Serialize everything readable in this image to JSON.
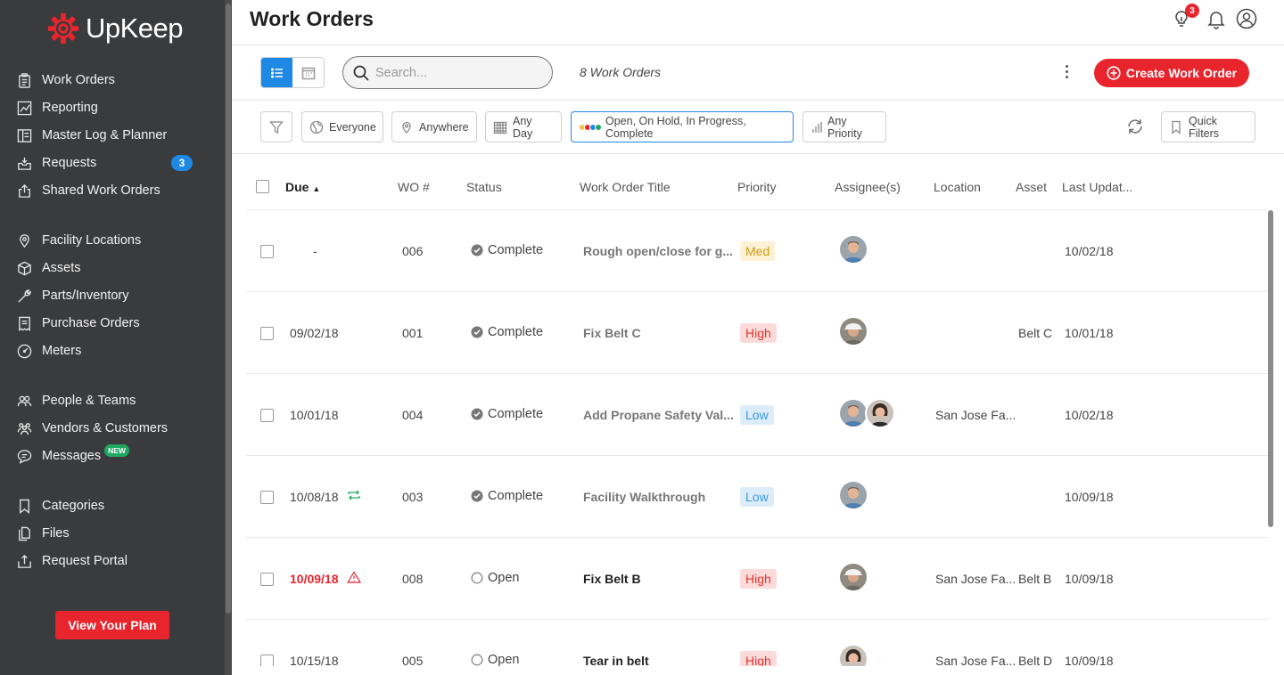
{
  "sidebar": {
    "brand": "UpKeep",
    "groups": [
      [
        {
          "label": "Work Orders",
          "icon": "clipboard-icon"
        },
        {
          "label": "Reporting",
          "icon": "chart-icon"
        },
        {
          "label": "Master Log & Planner",
          "icon": "planner-icon"
        },
        {
          "label": "Requests",
          "icon": "inbox-icon",
          "badge": "3"
        },
        {
          "label": "Shared Work Orders",
          "icon": "share-icon"
        }
      ],
      [
        {
          "label": "Facility Locations",
          "icon": "location-icon"
        },
        {
          "label": "Assets",
          "icon": "cube-icon"
        },
        {
          "label": "Parts/Inventory",
          "icon": "wrench-icon"
        },
        {
          "label": "Purchase Orders",
          "icon": "receipt-icon"
        },
        {
          "label": "Meters",
          "icon": "gauge-icon"
        }
      ],
      [
        {
          "label": "People & Teams",
          "icon": "people-icon"
        },
        {
          "label": "Vendors & Customers",
          "icon": "vendors-icon"
        },
        {
          "label": "Messages",
          "icon": "chat-icon",
          "badge_new": "NEW"
        }
      ],
      [
        {
          "label": "Categories",
          "icon": "bookmark-icon"
        },
        {
          "label": "Files",
          "icon": "files-icon"
        },
        {
          "label": "Request Portal",
          "icon": "portal-icon"
        }
      ]
    ],
    "plan_button": "View Your Plan"
  },
  "header": {
    "title": "Work Orders",
    "notifications_badge": "3"
  },
  "toolbar": {
    "search_placeholder": "Search...",
    "count_label": "8 Work Orders",
    "create_button": "Create Work Order"
  },
  "filters": {
    "everyone": "Everyone",
    "anywhere": "Anywhere",
    "any_day": "Any Day",
    "status": "Open, On Hold, In Progress, Complete",
    "priority": "Any Priority",
    "quick_filters": "Quick Filters",
    "status_colors": [
      "#f5c242",
      "#e8242d",
      "#1e88e5",
      "#1ea860"
    ]
  },
  "table": {
    "columns": {
      "due": "Due",
      "wo": "WO #",
      "status": "Status",
      "title": "Work Order Title",
      "priority": "Priority",
      "assignees": "Assignee(s)",
      "location": "Location",
      "asset": "Asset",
      "updated": "Last Updat..."
    },
    "rows": [
      {
        "due": "-",
        "wo": "006",
        "status": "Complete",
        "title": "Rough open/close for g...",
        "priority": "Med",
        "location": "",
        "asset": "",
        "updated": "10/02/18"
      },
      {
        "due": "09/02/18",
        "wo": "001",
        "status": "Complete",
        "title": "Fix Belt C",
        "priority": "High",
        "location": "",
        "asset": "Belt C",
        "updated": "10/01/18"
      },
      {
        "due": "10/01/18",
        "wo": "004",
        "status": "Complete",
        "title": "Add Propane Safety Val...",
        "priority": "Low",
        "location": "San Jose Fa...",
        "asset": "",
        "updated": "10/02/18"
      },
      {
        "due": "10/08/18",
        "wo": "003",
        "status": "Complete",
        "title": "Facility Walkthrough",
        "priority": "Low",
        "location": "",
        "asset": "",
        "updated": "10/09/18"
      },
      {
        "due": "10/09/18",
        "wo": "008",
        "status": "Open",
        "title": "Fix Belt B",
        "priority": "High",
        "location": "San Jose Fa...",
        "asset": "Belt B",
        "updated": "10/09/18"
      },
      {
        "due": "10/15/18",
        "wo": "005",
        "status": "Open",
        "title": "Tear in belt",
        "priority": "High",
        "location": "San Jose Fa...",
        "asset": "Belt D",
        "updated": "10/09/18"
      }
    ]
  }
}
